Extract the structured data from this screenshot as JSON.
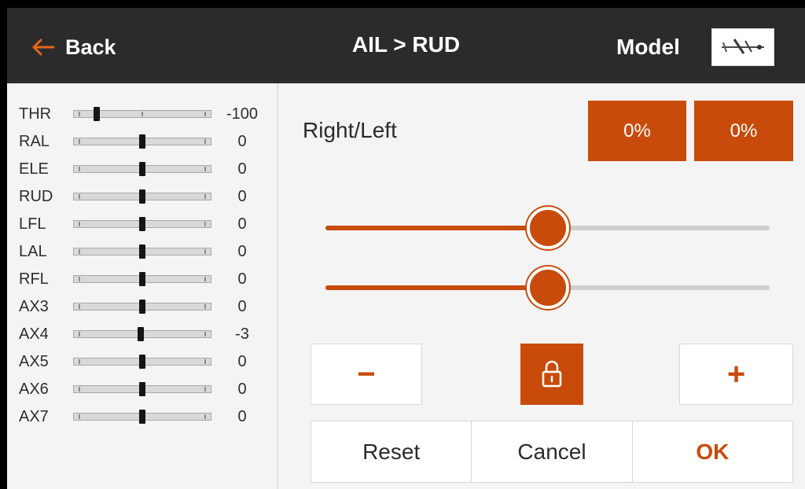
{
  "header": {
    "back_label": "Back",
    "title": "AIL > RUD",
    "model_label": "Model"
  },
  "colors": {
    "accent": "#c84b0c",
    "header_bg": "#2b2b2b",
    "panel_bg": "#f4f4f4"
  },
  "monitor": {
    "channels": [
      {
        "name": "THR",
        "value": "-100",
        "position": -100
      },
      {
        "name": "RAL",
        "value": "0",
        "position": 0
      },
      {
        "name": "ELE",
        "value": "0",
        "position": 0
      },
      {
        "name": "RUD",
        "value": "0",
        "position": 0
      },
      {
        "name": "LFL",
        "value": "0",
        "position": 0
      },
      {
        "name": "LAL",
        "value": "0",
        "position": 0
      },
      {
        "name": "RFL",
        "value": "0",
        "position": 0
      },
      {
        "name": "AX3",
        "value": "0",
        "position": 0
      },
      {
        "name": "AX4",
        "value": "-3",
        "position": -3
      },
      {
        "name": "AX5",
        "value": "0",
        "position": 0
      },
      {
        "name": "AX6",
        "value": "0",
        "position": 0
      },
      {
        "name": "AX7",
        "value": "0",
        "position": 0
      }
    ]
  },
  "editor": {
    "field_label": "Right/Left",
    "right_value": "0%",
    "left_value": "0%",
    "sliders": [
      {
        "name": "right",
        "fraction": 0.5
      },
      {
        "name": "left",
        "fraction": 0.5
      }
    ],
    "decrement_symbol": "−",
    "increment_symbol": "+",
    "lock_icon": "lock-icon"
  },
  "actions": {
    "reset_label": "Reset",
    "cancel_label": "Cancel",
    "ok_label": "OK"
  }
}
